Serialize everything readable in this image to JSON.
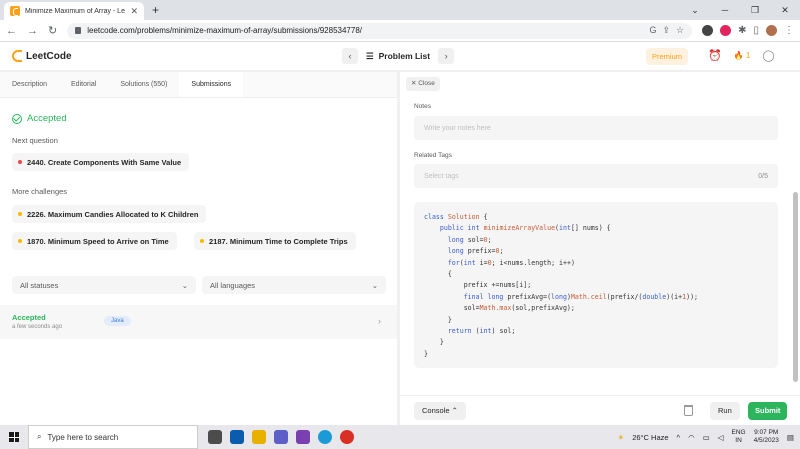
{
  "browser": {
    "tab_title": "Minimize Maximum of Array - LeetCode",
    "url": "leetcode.com/problems/minimize-maximum-of-array/submissions/928534778/"
  },
  "header": {
    "logo_text": "LeetCode",
    "problem_list_label": "Problem List",
    "premium_label": "Premium",
    "streak_count": "1"
  },
  "left_tabs": [
    "Description",
    "Editorial",
    "Solutions (550)",
    "Submissions"
  ],
  "result": {
    "status": "Accepted",
    "next_question_label": "Next question",
    "next_question": "2440. Create Components With Same Value",
    "more_challenges_label": "More challenges",
    "challenges": [
      "2226. Maximum Candies Allocated to K Children",
      "1870. Minimum Speed to Arrive on Time",
      "2187. Minimum Time to Complete Trips"
    ]
  },
  "filters": {
    "statuses": "All statuses",
    "languages": "All languages"
  },
  "submission": {
    "status": "Accepted",
    "time": "a few seconds ago",
    "language": "Java"
  },
  "right_panel": {
    "close_label": "Close",
    "notes_label": "Notes",
    "notes_placeholder": "Write your notes here",
    "tags_label": "Related Tags",
    "tags_placeholder": "Select tags",
    "tags_count": "0/5",
    "console_label": "Console",
    "run_label": "Run",
    "submit_label": "Submit"
  },
  "taskbar": {
    "search_placeholder": "Type here to search",
    "weather": "26°C  Haze",
    "lang": "ENG",
    "region": "IN",
    "time": "9:07 PM",
    "date": "4/5/2023"
  },
  "colors": {
    "accent_green": "#2db55d",
    "brand_orange": "#ffa116"
  }
}
